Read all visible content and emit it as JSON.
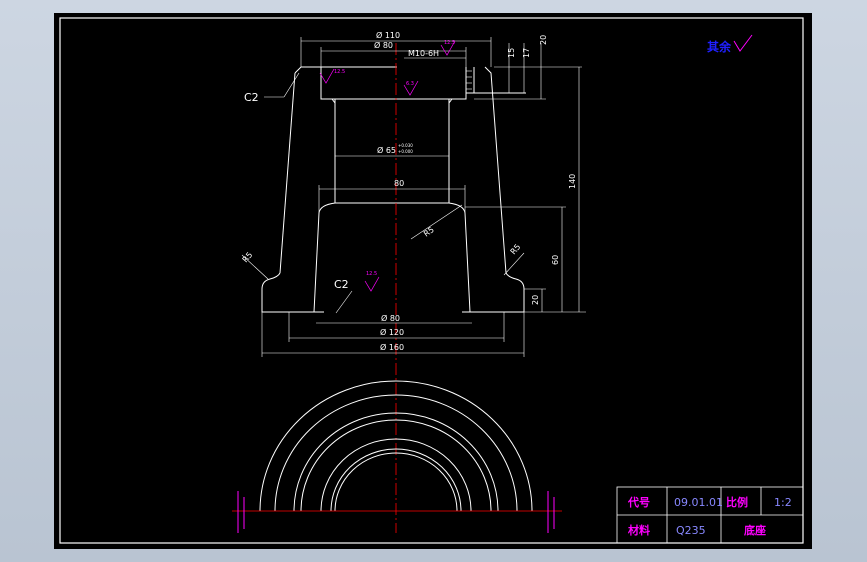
{
  "drawing": {
    "dimensions": {
      "d110": "Ø 110",
      "d80_top": "Ø 80",
      "thread": "M10-6H",
      "h15": "15",
      "h17": "17",
      "h20_top": "20",
      "h140": "140",
      "d65": "Ø 65",
      "d65_tol_upper": "+0.030",
      "d65_tol_lower": "+0.000",
      "w80": "80",
      "r5_center": "R5",
      "r5_left": "R5",
      "r5_right": "R5",
      "h60": "60",
      "h20_bottom": "20",
      "d80_bottom": "Ø 80",
      "d120": "Ø 120",
      "d160": "Ø 160"
    },
    "chamfer_top": "C2",
    "chamfer_bottom": "C2",
    "roughness": {
      "r1": "12.5",
      "r2": "12.5",
      "r3": "6.3",
      "r4": "12.5"
    },
    "rest_note": "其余",
    "colors": {
      "outline": "#ffffff",
      "centerline": "#ff0000",
      "symbols": "#ff00ff",
      "note": "#2020ff",
      "frame": "#ffffff"
    }
  },
  "title_block": {
    "code_label": "代号",
    "code_value": "09.01.01",
    "scale_label": "比例",
    "scale_value": "1:2",
    "material_label": "材料",
    "material_value": "Q235",
    "part_name": "底座"
  }
}
